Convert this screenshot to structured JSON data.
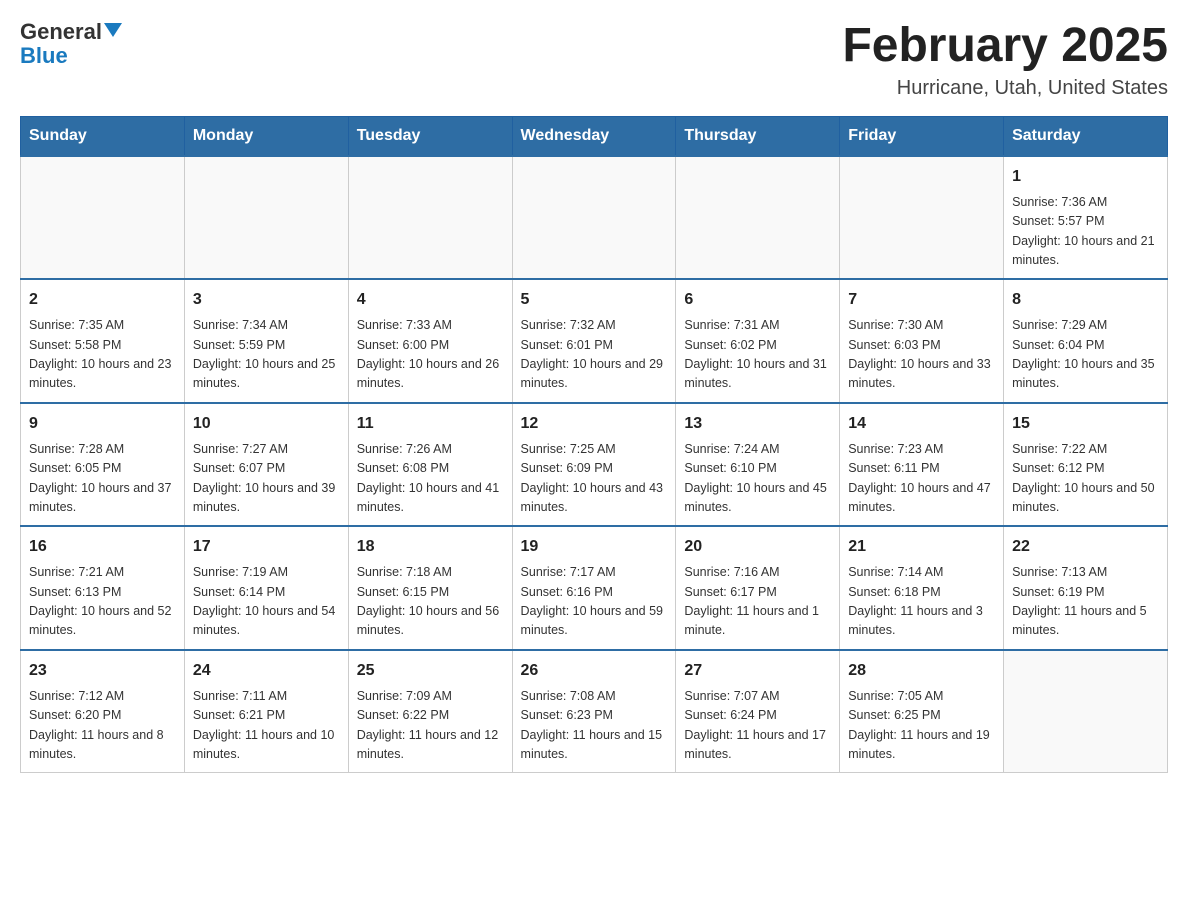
{
  "logo": {
    "text_general": "General",
    "text_blue": "Blue"
  },
  "header": {
    "month_year": "February 2025",
    "location": "Hurricane, Utah, United States"
  },
  "days_of_week": [
    "Sunday",
    "Monday",
    "Tuesday",
    "Wednesday",
    "Thursday",
    "Friday",
    "Saturday"
  ],
  "weeks": [
    [
      {
        "day": "",
        "info": ""
      },
      {
        "day": "",
        "info": ""
      },
      {
        "day": "",
        "info": ""
      },
      {
        "day": "",
        "info": ""
      },
      {
        "day": "",
        "info": ""
      },
      {
        "day": "",
        "info": ""
      },
      {
        "day": "1",
        "info": "Sunrise: 7:36 AM\nSunset: 5:57 PM\nDaylight: 10 hours and 21 minutes."
      }
    ],
    [
      {
        "day": "2",
        "info": "Sunrise: 7:35 AM\nSunset: 5:58 PM\nDaylight: 10 hours and 23 minutes."
      },
      {
        "day": "3",
        "info": "Sunrise: 7:34 AM\nSunset: 5:59 PM\nDaylight: 10 hours and 25 minutes."
      },
      {
        "day": "4",
        "info": "Sunrise: 7:33 AM\nSunset: 6:00 PM\nDaylight: 10 hours and 26 minutes."
      },
      {
        "day": "5",
        "info": "Sunrise: 7:32 AM\nSunset: 6:01 PM\nDaylight: 10 hours and 29 minutes."
      },
      {
        "day": "6",
        "info": "Sunrise: 7:31 AM\nSunset: 6:02 PM\nDaylight: 10 hours and 31 minutes."
      },
      {
        "day": "7",
        "info": "Sunrise: 7:30 AM\nSunset: 6:03 PM\nDaylight: 10 hours and 33 minutes."
      },
      {
        "day": "8",
        "info": "Sunrise: 7:29 AM\nSunset: 6:04 PM\nDaylight: 10 hours and 35 minutes."
      }
    ],
    [
      {
        "day": "9",
        "info": "Sunrise: 7:28 AM\nSunset: 6:05 PM\nDaylight: 10 hours and 37 minutes."
      },
      {
        "day": "10",
        "info": "Sunrise: 7:27 AM\nSunset: 6:07 PM\nDaylight: 10 hours and 39 minutes."
      },
      {
        "day": "11",
        "info": "Sunrise: 7:26 AM\nSunset: 6:08 PM\nDaylight: 10 hours and 41 minutes."
      },
      {
        "day": "12",
        "info": "Sunrise: 7:25 AM\nSunset: 6:09 PM\nDaylight: 10 hours and 43 minutes."
      },
      {
        "day": "13",
        "info": "Sunrise: 7:24 AM\nSunset: 6:10 PM\nDaylight: 10 hours and 45 minutes."
      },
      {
        "day": "14",
        "info": "Sunrise: 7:23 AM\nSunset: 6:11 PM\nDaylight: 10 hours and 47 minutes."
      },
      {
        "day": "15",
        "info": "Sunrise: 7:22 AM\nSunset: 6:12 PM\nDaylight: 10 hours and 50 minutes."
      }
    ],
    [
      {
        "day": "16",
        "info": "Sunrise: 7:21 AM\nSunset: 6:13 PM\nDaylight: 10 hours and 52 minutes."
      },
      {
        "day": "17",
        "info": "Sunrise: 7:19 AM\nSunset: 6:14 PM\nDaylight: 10 hours and 54 minutes."
      },
      {
        "day": "18",
        "info": "Sunrise: 7:18 AM\nSunset: 6:15 PM\nDaylight: 10 hours and 56 minutes."
      },
      {
        "day": "19",
        "info": "Sunrise: 7:17 AM\nSunset: 6:16 PM\nDaylight: 10 hours and 59 minutes."
      },
      {
        "day": "20",
        "info": "Sunrise: 7:16 AM\nSunset: 6:17 PM\nDaylight: 11 hours and 1 minute."
      },
      {
        "day": "21",
        "info": "Sunrise: 7:14 AM\nSunset: 6:18 PM\nDaylight: 11 hours and 3 minutes."
      },
      {
        "day": "22",
        "info": "Sunrise: 7:13 AM\nSunset: 6:19 PM\nDaylight: 11 hours and 5 minutes."
      }
    ],
    [
      {
        "day": "23",
        "info": "Sunrise: 7:12 AM\nSunset: 6:20 PM\nDaylight: 11 hours and 8 minutes."
      },
      {
        "day": "24",
        "info": "Sunrise: 7:11 AM\nSunset: 6:21 PM\nDaylight: 11 hours and 10 minutes."
      },
      {
        "day": "25",
        "info": "Sunrise: 7:09 AM\nSunset: 6:22 PM\nDaylight: 11 hours and 12 minutes."
      },
      {
        "day": "26",
        "info": "Sunrise: 7:08 AM\nSunset: 6:23 PM\nDaylight: 11 hours and 15 minutes."
      },
      {
        "day": "27",
        "info": "Sunrise: 7:07 AM\nSunset: 6:24 PM\nDaylight: 11 hours and 17 minutes."
      },
      {
        "day": "28",
        "info": "Sunrise: 7:05 AM\nSunset: 6:25 PM\nDaylight: 11 hours and 19 minutes."
      },
      {
        "day": "",
        "info": ""
      }
    ]
  ]
}
